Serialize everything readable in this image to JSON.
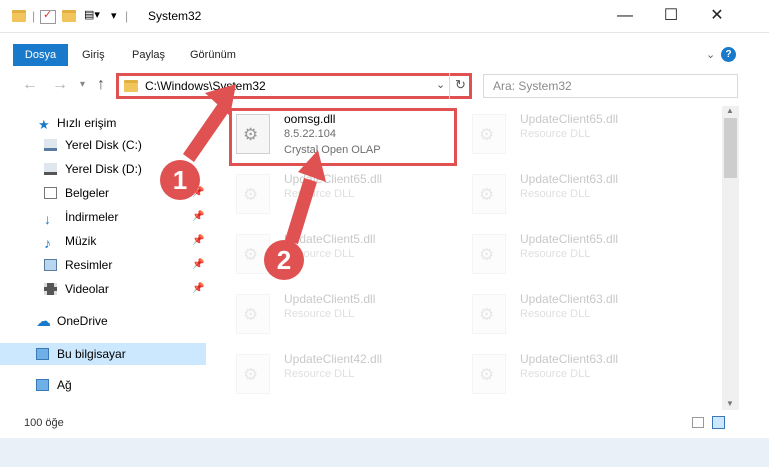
{
  "window": {
    "title": "System32",
    "controls": {
      "minimize": "—",
      "maximize": "☐",
      "close": "✕"
    }
  },
  "ribbon": {
    "tabs": [
      "Dosya",
      "Giriş",
      "Paylaş",
      "Görünüm"
    ],
    "help_glyph": "?",
    "collapse_glyph": "⌄"
  },
  "address": {
    "path": "C:\\Windows\\System32",
    "search_placeholder": "Ara: System32"
  },
  "sidebar": {
    "items": [
      {
        "label": "Hızlı erişim",
        "icon": "star-icon"
      },
      {
        "label": "Yerel Disk (C:)",
        "icon": "drive-icon"
      },
      {
        "label": "Yerel Disk (D:)",
        "icon": "drive-icon"
      },
      {
        "label": "Belgeler",
        "icon": "document-icon"
      },
      {
        "label": "İndirmeler",
        "icon": "download-icon"
      },
      {
        "label": "Müzik",
        "icon": "music-icon"
      },
      {
        "label": "Resimler",
        "icon": "pictures-icon"
      },
      {
        "label": "Videolar",
        "icon": "video-icon"
      },
      {
        "label": "OneDrive",
        "icon": "cloud-icon"
      },
      {
        "label": "Bu bilgisayar",
        "icon": "computer-icon"
      },
      {
        "label": "Ağ",
        "icon": "network-icon"
      }
    ]
  },
  "files": {
    "main": {
      "name": "oomsg.dll",
      "version": "8.5.22.104",
      "description": "Crystal Open OLAP"
    },
    "faded": [
      {
        "name": "UpdateClient65.dll",
        "desc": "Resource DLL"
      },
      {
        "name": "UpdateClient65.dll",
        "desc": "Resource DLL"
      },
      {
        "name": "UpdateClient63.dll",
        "desc": "Resource DLL"
      },
      {
        "name": "UpdateClient5.dll",
        "desc": "Resource DLL"
      },
      {
        "name": "UpdateClient65.dll",
        "desc": "Resource DLL"
      },
      {
        "name": "UpdateClient5.dll",
        "desc": "Resource DLL"
      },
      {
        "name": "UpdateClient63.dll",
        "desc": "Resource DLL"
      },
      {
        "name": "UpdateClient42.dll",
        "desc": "Resource DLL"
      },
      {
        "name": "UpdateClient63.dll",
        "desc": "Resource DLL"
      }
    ]
  },
  "status": {
    "item_count": "100 öğe"
  },
  "annotations": {
    "step1": "1",
    "step2": "2"
  },
  "colors": {
    "accent": "#1979ca",
    "highlight": "#e05252",
    "selection": "#cce8ff"
  }
}
